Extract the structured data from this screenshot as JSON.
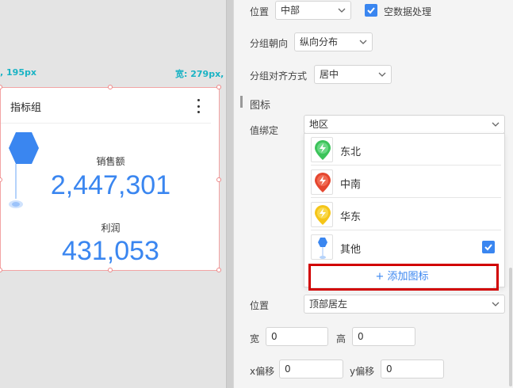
{
  "canvas": {
    "dim_left": ", 195px",
    "dim_right": "宽: 279px, ",
    "card": {
      "title": "指标组",
      "metrics": [
        {
          "label": "销售额",
          "value": "2,447,301"
        },
        {
          "label": "利润",
          "value": "431,053"
        }
      ]
    }
  },
  "panel": {
    "position_label": "位置",
    "position_value": "中部",
    "empty_data_label": "空数据处理",
    "empty_data_checked": true,
    "group_direction_label": "分组朝向",
    "group_direction_value": "纵向分布",
    "group_align_label": "分组对齐方式",
    "group_align_value": "居中",
    "icon_section_title": "图标",
    "value_binding_label": "值绑定",
    "value_binding_value": "地区",
    "icon_options": [
      {
        "label": "东北",
        "icon": "lightning-pin-icon",
        "color": "#3cc35a"
      },
      {
        "label": "中南",
        "icon": "lightning-pin-icon",
        "color": "#e5462f"
      },
      {
        "label": "华东",
        "icon": "lightning-pin-icon",
        "color": "#f5c518"
      },
      {
        "label": "其他",
        "icon": "hexagon-pin-icon",
        "color": "#3a86f0",
        "checked": true
      }
    ],
    "add_icon_label": "+ 添加图标",
    "icon_position_label": "位置",
    "icon_position_value": "顶部居左",
    "width_label": "宽",
    "width_value": "0",
    "height_label": "高",
    "height_value": "0",
    "x_offset_label": "x偏移",
    "x_offset_value": "0",
    "y_offset_label": "y偏移",
    "y_offset_value": "0"
  }
}
